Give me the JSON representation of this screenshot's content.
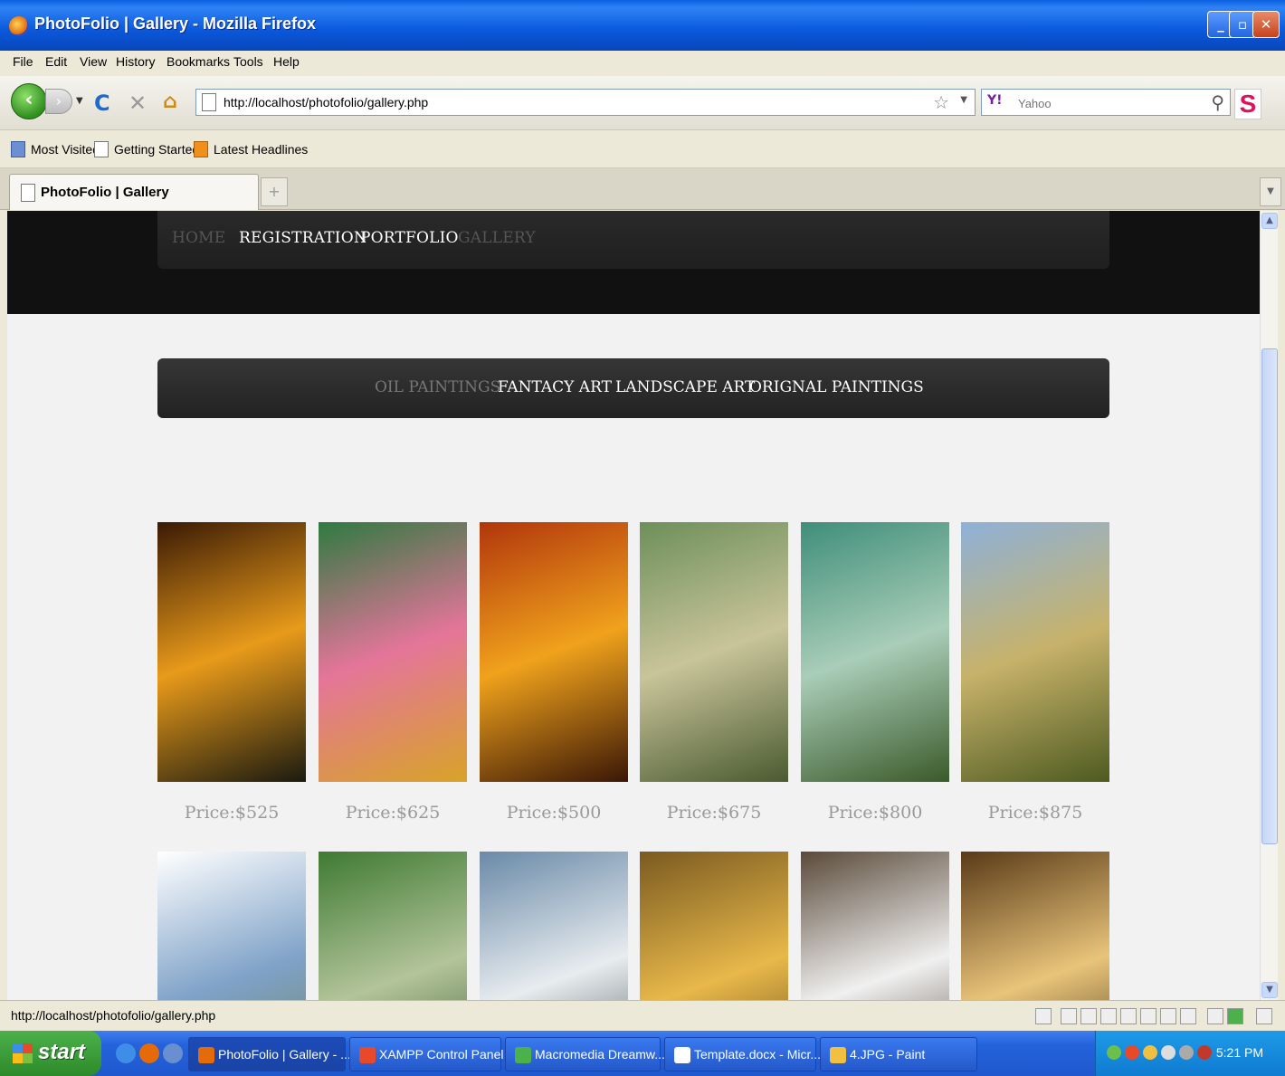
{
  "window": {
    "title": "PhotoFolio | Gallery - Mozilla Firefox",
    "minimize": "_",
    "maximize": "▫",
    "close": "✕"
  },
  "menu": [
    "File",
    "Edit",
    "View",
    "History",
    "Bookmarks",
    "Tools",
    "Help"
  ],
  "toolbar": {
    "url": "http://localhost/photofolio/gallery.php",
    "search_placeholder": "Yahoo",
    "search_engine": "Y!",
    "addon_label": "S"
  },
  "bookmarks": [
    "Most Visited",
    "Getting Started",
    "Latest Headlines"
  ],
  "tab": {
    "title": "PhotoFolio | Gallery",
    "new_tab": "+"
  },
  "site": {
    "nav": [
      {
        "label": "HOME",
        "dim": true
      },
      {
        "label": "REGISTRATION",
        "dim": false
      },
      {
        "label": "PORTFOLIO",
        "dim": false
      },
      {
        "label": "GALLERY",
        "dim": true
      }
    ],
    "categories": [
      {
        "label": "OIL PAINTINGS",
        "dim": true
      },
      {
        "label": "FANTACY ART",
        "dim": false
      },
      {
        "label": "LANDSCAPE ART",
        "dim": false
      },
      {
        "label": "ORIGNAL PAINTINGS",
        "dim": false
      }
    ],
    "gallery_row1": [
      {
        "price": "Price:$525",
        "palette": [
          "#3a1a05",
          "#e89a1a",
          "#1a1a10"
        ]
      },
      {
        "price": "Price:$625",
        "palette": [
          "#2f7a40",
          "#e4759a",
          "#d8a328"
        ]
      },
      {
        "price": "Price:$500",
        "palette": [
          "#b1360c",
          "#f0a21c",
          "#3a1706"
        ]
      },
      {
        "price": "Price:$675",
        "palette": [
          "#6d8f5a",
          "#c9c49a",
          "#4a5a30"
        ]
      },
      {
        "price": "Price:$800",
        "palette": [
          "#3f8e7a",
          "#a9cdb8",
          "#3b5a2a"
        ]
      },
      {
        "price": "Price:$875",
        "palette": [
          "#8eb1d8",
          "#c7b26a",
          "#4d5a20"
        ]
      }
    ],
    "gallery_row2": [
      {
        "palette": [
          "#ffffff",
          "#7fa2c8",
          "#6c8050"
        ]
      },
      {
        "palette": [
          "#3f7a33",
          "#b3c49a",
          "#2a4a20"
        ]
      },
      {
        "palette": [
          "#6a8aa8",
          "#e8ecef",
          "#2a3a3a"
        ]
      },
      {
        "palette": [
          "#7a5a20",
          "#e8b84a",
          "#4a3210"
        ]
      },
      {
        "palette": [
          "#5a4a3a",
          "#f0f0f0",
          "#3a2c20"
        ]
      },
      {
        "palette": [
          "#5a3a18",
          "#e8c47a",
          "#2a1a08"
        ]
      }
    ]
  },
  "status": {
    "text": "http://localhost/photofolio/gallery.php"
  },
  "taskbar": {
    "start": "start",
    "tasks": [
      {
        "label": "PhotoFolio | Gallery - ...",
        "color": "#e46b08",
        "active": true
      },
      {
        "label": "XAMPP Control Panel ...",
        "color": "#e8492b",
        "active": false
      },
      {
        "label": "Macromedia Dreamw...",
        "color": "#4cb14a",
        "active": false
      },
      {
        "label": "Template.docx - Micr...",
        "color": "#ffffff",
        "active": false
      },
      {
        "label": "4.JPG - Paint",
        "color": "#f0c040",
        "active": false
      }
    ],
    "clock": "5:21 PM"
  }
}
